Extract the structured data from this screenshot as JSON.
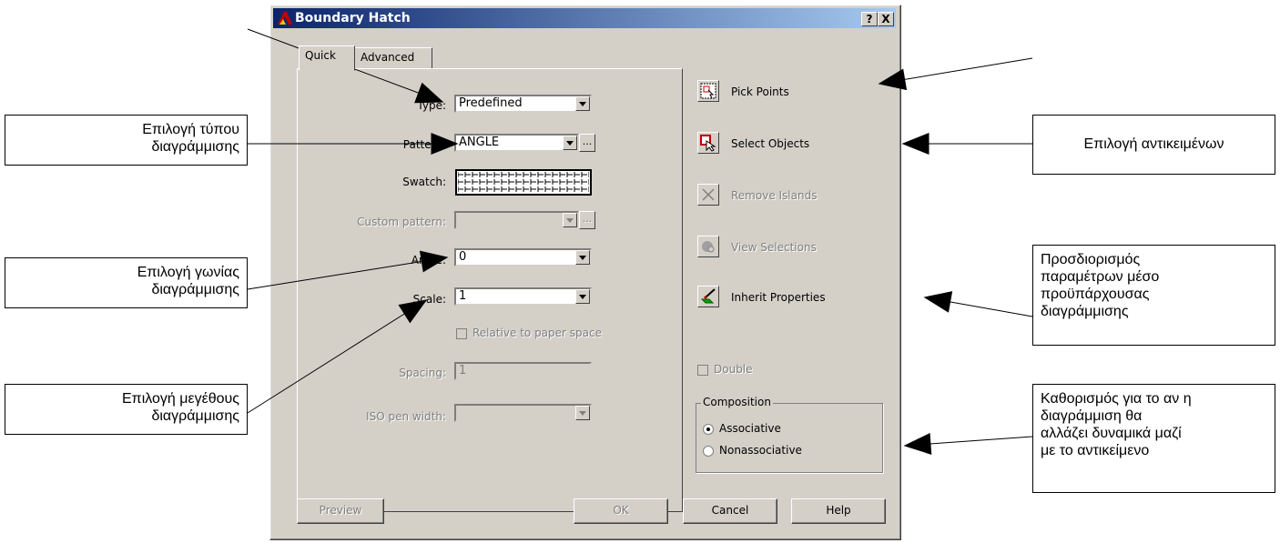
{
  "window": {
    "title": "Boundary Hatch",
    "help_btn": "?",
    "close_btn": "X"
  },
  "tabs": [
    {
      "label": "Quick"
    },
    {
      "label": "Advanced"
    }
  ],
  "fields": {
    "type": {
      "label": "Type:",
      "value": "Predefined"
    },
    "pattern": {
      "label": "Pattern:",
      "value": "ANGLE",
      "ellipsis": "..."
    },
    "swatch": {
      "label": "Swatch:"
    },
    "custom_pattern": {
      "label": "Custom pattern:",
      "value": "",
      "ellipsis": "..."
    },
    "angle": {
      "label": "Angle:",
      "value": "0"
    },
    "scale": {
      "label": "Scale:",
      "value": "1"
    },
    "relative_to_paper": {
      "label": "Relative to paper space",
      "checked": false
    },
    "spacing": {
      "label": "Spacing:",
      "value": "1"
    },
    "iso_pen_width": {
      "label": "ISO pen width:",
      "value": ""
    }
  },
  "actions": {
    "pick_points": "Pick Points",
    "select_objects": "Select Objects",
    "remove_islands": "Remove Islands",
    "view_selections": "View Selections",
    "inherit_properties": "Inherit Properties"
  },
  "double": {
    "label": "Double",
    "checked": false
  },
  "composition": {
    "title": "Composition",
    "options": [
      {
        "label": "Associative",
        "selected": true
      },
      {
        "label": "Nonassociative",
        "selected": false
      }
    ]
  },
  "buttons": {
    "preview": "Preview",
    "ok": "OK",
    "cancel": "Cancel",
    "help": "Help"
  },
  "callouts": {
    "hatch_type": [
      "Επιλογή τύπου",
      "διαγράμμισης"
    ],
    "hatch_angle": [
      "Επιλογή γωνίας",
      "διαγράμμισης"
    ],
    "hatch_scale": [
      "Επιλογή μεγέθους",
      "διαγράμμισης"
    ],
    "select_objects": [
      "Επιλογή αντικειμένων"
    ],
    "inherit": [
      "Προσδιορισμός",
      "παραμέτρων μέσο",
      "προϋπάρχουσας",
      "διαγράμμισης"
    ],
    "associative": [
      "Καθορισμός για το αν η",
      "διαγράμμιση θα",
      "αλλάζει δυναμικά μαζί",
      "με το αντικείμενο"
    ]
  },
  "colors": {
    "dialog_bg": "#d4d0c8",
    "title_start": "#0a246a",
    "title_end": "#a6caf0"
  }
}
